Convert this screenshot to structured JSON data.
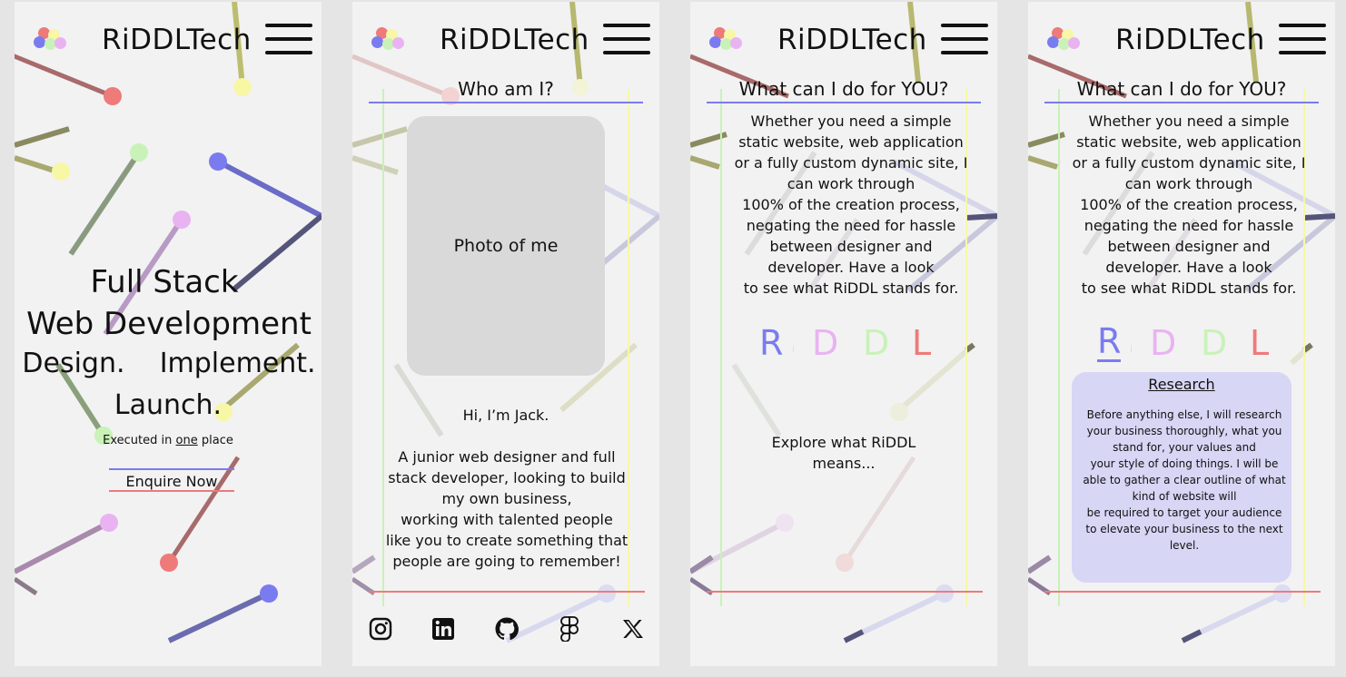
{
  "brand": "RiDDLTech",
  "colors": {
    "red": "#ee7a7a",
    "blue": "#7b7bf0",
    "pink": "#e9b3f2",
    "green": "#c9f2b8",
    "yellow": "#f7f7a6",
    "background": "#f2f2f2",
    "photo_placeholder": "#d9d9d9",
    "card": "#d7d6f5"
  },
  "header": {
    "logo_icon": "colored-dots-logo",
    "menu_icon": "hamburger-menu-icon"
  },
  "screens": {
    "home": {
      "headline_line1": "Full Stack",
      "headline_line2": "Web Development",
      "tagline_design": "Design.",
      "tagline_implement": "Implement.",
      "tagline_launch": "Launch.",
      "executed_prefix": "Executed in",
      "executed_emphasis": "one",
      "executed_suffix": "place",
      "enquire_button": "Enquire Now"
    },
    "about": {
      "title": "Who am I?",
      "photo_placeholder": "Photo of me",
      "greeting": "Hi, I’m Jack.",
      "bio_lines": [
        "A junior web designer and full",
        "stack developer, looking to build",
        "my own business,",
        "working with talented people",
        "like you to create something that",
        "people are going to remember!"
      ],
      "social_icons": [
        "instagram-icon",
        "linkedin-icon",
        "github-icon",
        "figma-icon",
        "x-icon"
      ]
    },
    "services": {
      "title": "What can I do for YOU?",
      "description_lines": [
        "Whether you need a simple",
        "static website, web application",
        "or a fully custom dynamic site, I",
        "can work through",
        "100% of the creation process,",
        "negating the need for hassle",
        "between designer and",
        "developer. Have a look",
        "to see what RiDDL stands for."
      ],
      "riddl_letters": [
        "R",
        "i",
        "D",
        "D",
        "L"
      ],
      "explore_lines": [
        "Explore what RiDDL",
        "means..."
      ]
    },
    "research": {
      "title": "What can I do for YOU?",
      "card_title": "Research",
      "card_lines": [
        "Before anything else, I will research",
        "your business thoroughly, what you",
        "stand for, your values and",
        "your style of doing things. I will be",
        "able to gather a clear outline of what",
        "kind of website will",
        "be required to target your audience",
        "to elevate your business to the next",
        "level."
      ]
    }
  }
}
